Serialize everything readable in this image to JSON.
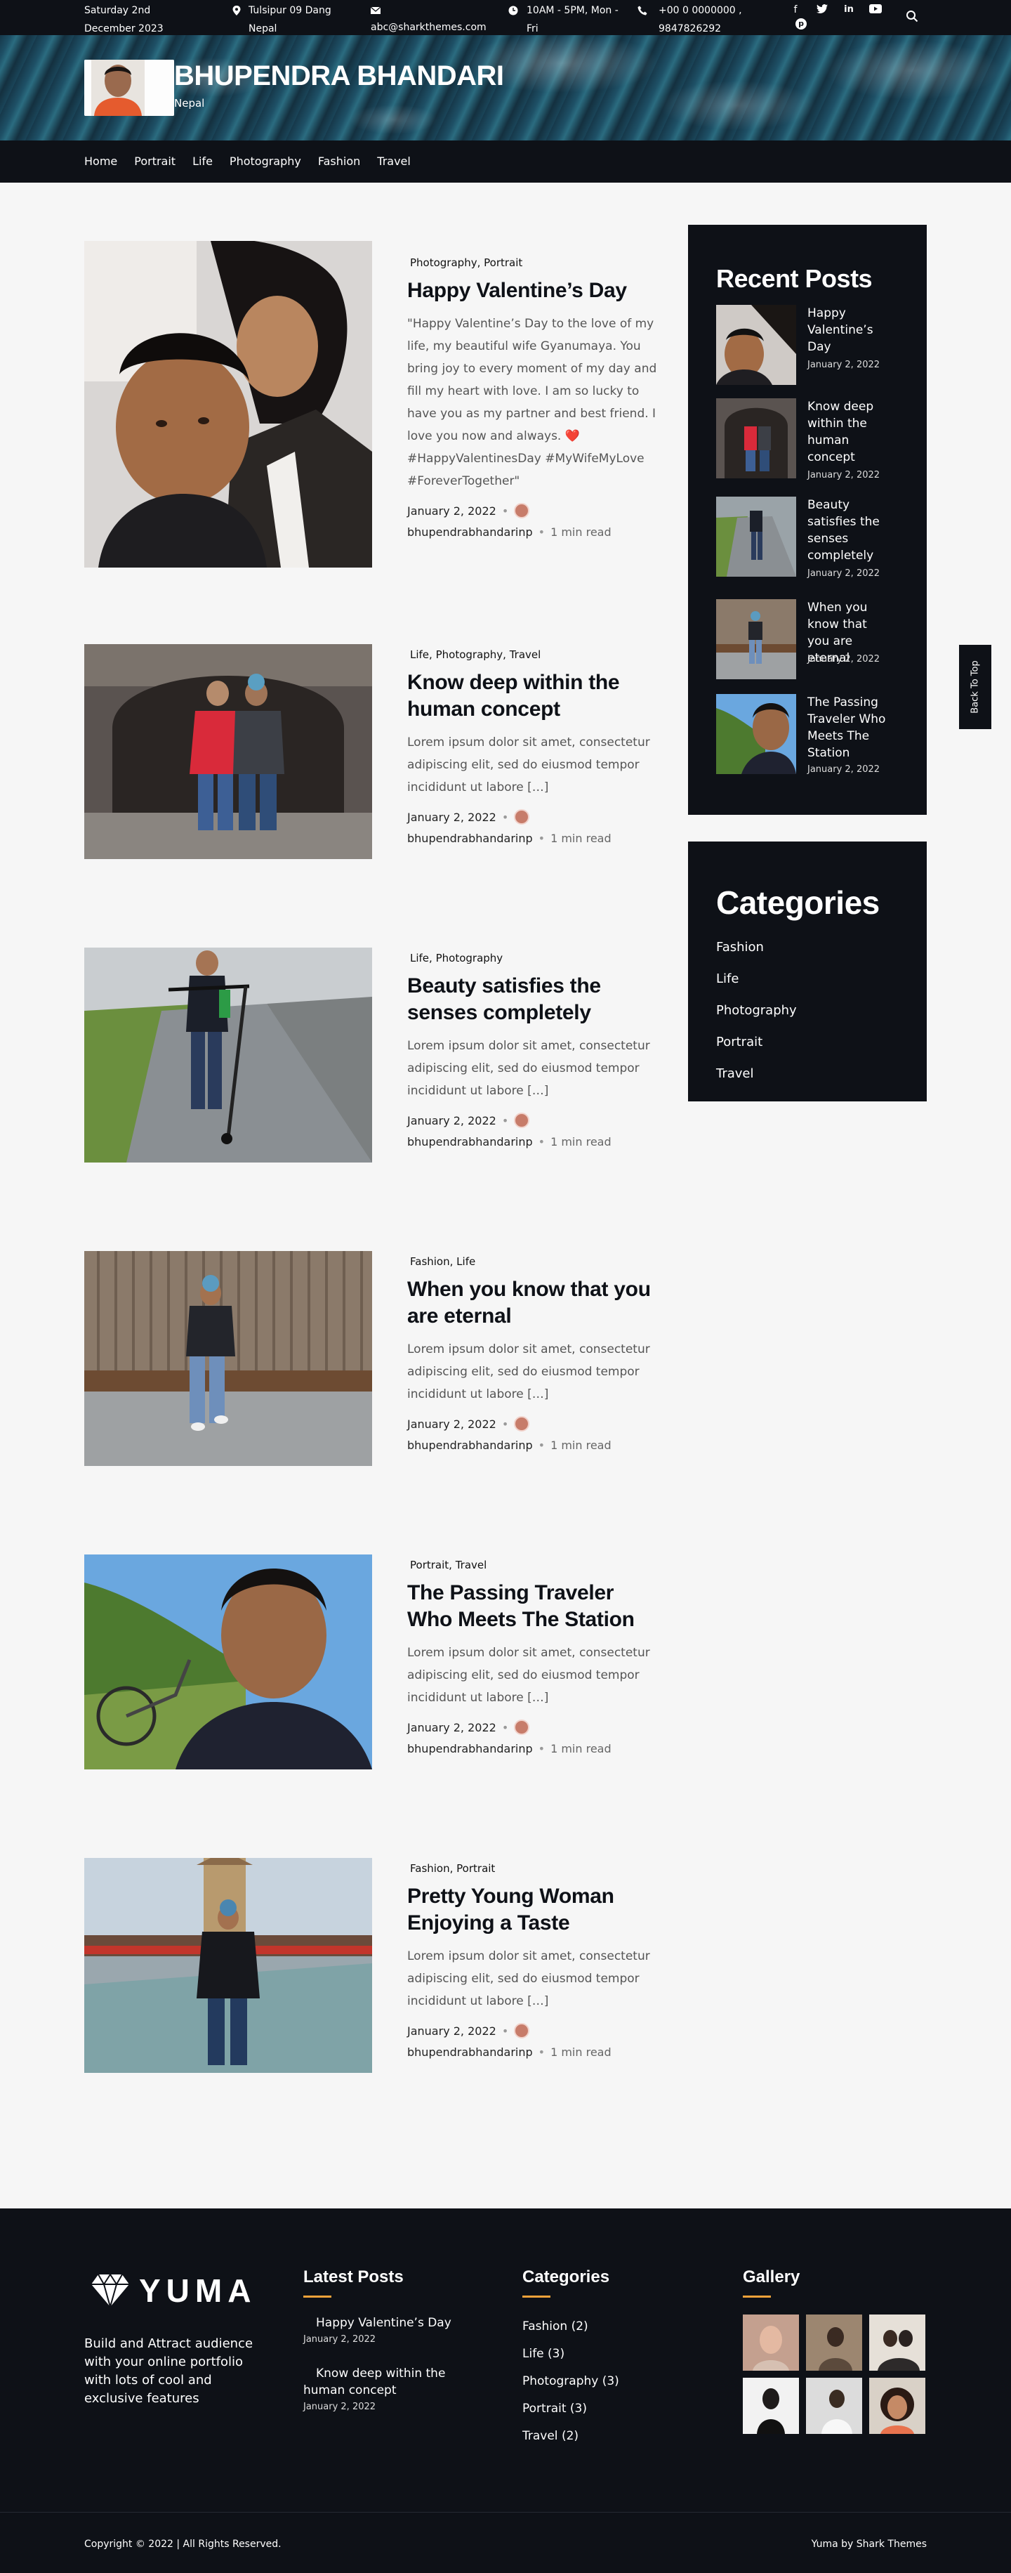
{
  "topbar": {
    "date": "Saturday 2nd December 2023",
    "location": "Tulsipur 09 Dang Nepal",
    "email": "abc@sharkthemes.com",
    "hours": "10AM - 5PM, Mon - Fri",
    "phones": "+00 0 0000000 , 9847826292"
  },
  "header": {
    "site_title": "BHUPENDRA BHANDARI",
    "tagline": "Nepal"
  },
  "nav": {
    "items": [
      "Home",
      "Portrait",
      "Life",
      "Photography",
      "Fashion",
      "Travel"
    ]
  },
  "posts": [
    {
      "categories": [
        "Photography",
        "Portrait"
      ],
      "title": "Happy Valentine’s Day",
      "excerpt": "\"Happy Valentine’s Day to the love of my life, my beautiful wife Gyanumaya. You bring joy to every moment of my day and fill my heart with love. I am so lucky to have you as my partner and best friend. I love you now and always. ❤️ #HappyValentinesDay #MyWifeMyLove #ForeverTogether\"",
      "date": "January 2, 2022",
      "author": "bhupendrabhandarinp",
      "read_time": "1 min read"
    },
    {
      "categories": [
        "Life",
        "Photography",
        "Travel"
      ],
      "title": "Know deep within the human concept",
      "excerpt": "Lorem ipsum dolor sit amet, consectetur adipiscing elit, sed do eiusmod tempor incididunt ut labore […]",
      "date": "January 2, 2022",
      "author": "bhupendrabhandarinp",
      "read_time": "1 min read"
    },
    {
      "categories": [
        "Life",
        "Photography"
      ],
      "title": "Beauty satisfies the senses completely",
      "excerpt": "Lorem ipsum dolor sit amet, consectetur adipiscing elit, sed do eiusmod tempor incididunt ut labore […]",
      "date": "January 2, 2022",
      "author": "bhupendrabhandarinp",
      "read_time": "1 min read"
    },
    {
      "categories": [
        "Fashion",
        "Life"
      ],
      "title": "When you know that you are eternal",
      "excerpt": "Lorem ipsum dolor sit amet, consectetur adipiscing elit, sed do eiusmod tempor incididunt ut labore […]",
      "date": "January 2, 2022",
      "author": "bhupendrabhandarinp",
      "read_time": "1 min read"
    },
    {
      "categories": [
        "Portrait",
        "Travel"
      ],
      "title": "The Passing Traveler Who Meets The Station",
      "excerpt": "Lorem ipsum dolor sit amet, consectetur adipiscing elit, sed do eiusmod tempor incididunt ut labore […]",
      "date": "January 2, 2022",
      "author": "bhupendrabhandarinp",
      "read_time": "1 min read"
    },
    {
      "categories": [
        "Fashion",
        "Portrait"
      ],
      "title": "Pretty Young Woman Enjoying a Taste",
      "excerpt": "Lorem ipsum dolor sit amet, consectetur adipiscing elit, sed do eiusmod tempor incididunt ut labore […]",
      "date": "January 2, 2022",
      "author": "bhupendrabhandarinp",
      "read_time": "1 min read"
    }
  ],
  "sidebar": {
    "recent_title": "Recent Posts",
    "recent": [
      {
        "title": "Happy Valentine’s Day",
        "date": "January 2, 2022"
      },
      {
        "title": "Know deep within the human concept",
        "date": "January 2, 2022"
      },
      {
        "title": "Beauty satisfies the senses completely",
        "date": "January 2, 2022"
      },
      {
        "title": "When you know that you are eternal",
        "date": "January 2, 2022"
      },
      {
        "title": "The Passing Traveler Who Meets The Station",
        "date": "January 2, 2022"
      }
    ],
    "categories_title": "Categories",
    "categories": [
      "Fashion",
      "Life",
      "Photography",
      "Portrait",
      "Travel"
    ],
    "back_to_top": "Back To Top"
  },
  "footer": {
    "logo_text": "YUMA",
    "description": "Build and Attract audience with your online portfolio with lots of cool and exclusive features",
    "latest_title": "Latest Posts",
    "latest": [
      {
        "title": "Happy Valentine’s Day",
        "date": "January 2, 2022"
      },
      {
        "title": "Know deep within the human concept",
        "date": "January 2, 2022"
      }
    ],
    "categories_title": "Categories",
    "categories": [
      "Fashion (2)",
      "Life (3)",
      "Photography (3)",
      "Portrait (3)",
      "Travel (2)"
    ],
    "gallery_title": "Gallery",
    "copyright": "Copyright © 2022 | All Rights Reserved.",
    "credit": "Yuma by Shark Themes"
  },
  "colors": {
    "dark": "#0e1117",
    "accent": "#f3a23a",
    "background": "#f6f6f6"
  }
}
